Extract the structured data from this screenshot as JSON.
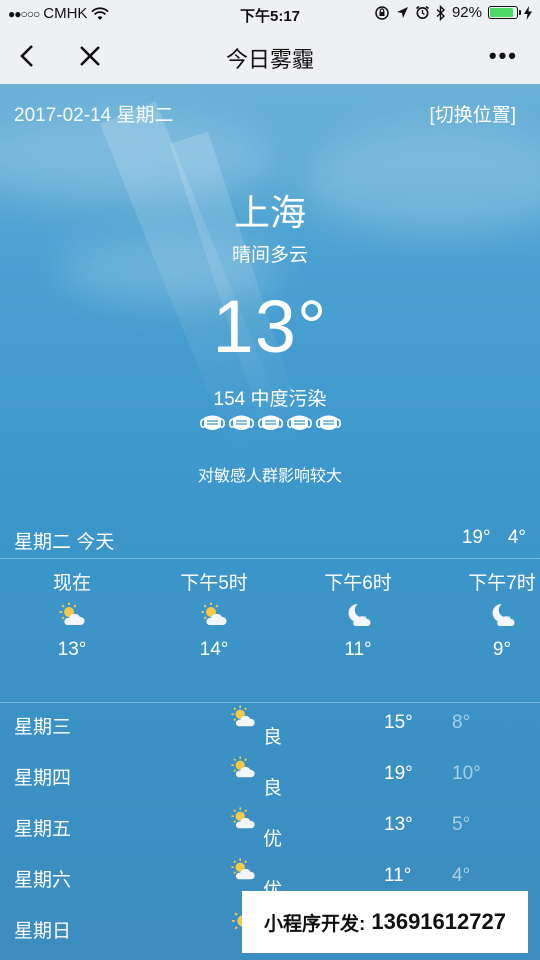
{
  "status": {
    "carrier": "CMHK",
    "time": "下午5:17",
    "battery": "92%",
    "battery_level": 0.92
  },
  "nav": {
    "title": "今日雾霾"
  },
  "header": {
    "date": "2017-02-14 星期二",
    "switch_label": "[切换位置]"
  },
  "current": {
    "city": "上海",
    "condition": "晴间多云",
    "temperature": "13°",
    "aqi": "154 中度污染",
    "mask_level": 5,
    "advice": "对敏感人群影响较大"
  },
  "today": {
    "label": "星期二 今天",
    "high": "19°",
    "low": "4°"
  },
  "hourly": [
    {
      "time": "现在",
      "icon": "sun-cloud-icon",
      "temp": "13°"
    },
    {
      "time": "下午5时",
      "icon": "sun-cloud-icon",
      "temp": "14°"
    },
    {
      "time": "下午6时",
      "icon": "moon-cloud-icon",
      "temp": "11°"
    },
    {
      "time": "下午7时",
      "icon": "moon-cloud-icon",
      "temp": "9°"
    }
  ],
  "daily": [
    {
      "day": "星期三",
      "icon": "sun-cloud-icon",
      "quality": "良",
      "high": "15°",
      "low": "8°"
    },
    {
      "day": "星期四",
      "icon": "sun-cloud-icon",
      "quality": "良",
      "high": "19°",
      "low": "10°"
    },
    {
      "day": "星期五",
      "icon": "sun-cloud-icon",
      "quality": "优",
      "high": "13°",
      "low": "5°"
    },
    {
      "day": "星期六",
      "icon": "sun-cloud-icon",
      "quality": "优",
      "high": "11°",
      "low": "4°"
    },
    {
      "day": "星期日",
      "icon": "sun-icon",
      "quality": "",
      "high": "",
      "low": ""
    }
  ],
  "ad": {
    "label": "小程序开发:",
    "phone": "13691612727"
  },
  "colors": {
    "sun": "#f7c948",
    "cloud": "#f2f6fa",
    "moon": "#f5f7fb",
    "battery": "#4cd964"
  }
}
